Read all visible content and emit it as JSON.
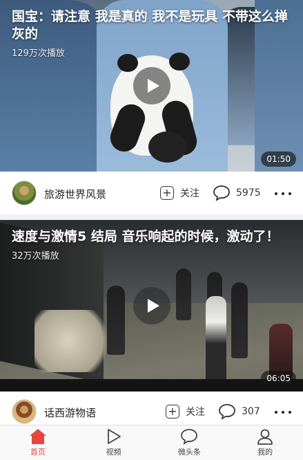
{
  "videos": [
    {
      "title": "国宝：请注意 我是真的 我不是玩具 不带这么掸灰的",
      "play_count": "129万次播放",
      "duration": "01:50",
      "channel": "旅游世界风景",
      "follow_label": "关注",
      "comment_count": "5975"
    },
    {
      "title": "速度与激情5 结局 音乐响起的时候，激动了！",
      "play_count": "32万次播放",
      "duration": "06:05",
      "channel": "话西游物语",
      "follow_label": "关注",
      "comment_count": "307"
    }
  ],
  "tabbar": {
    "items": [
      {
        "label": "首页",
        "icon": "home-icon",
        "active": true
      },
      {
        "label": "视频",
        "icon": "play-icon",
        "active": false
      },
      {
        "label": "微头条",
        "icon": "chat-bubble-icon",
        "active": false
      },
      {
        "label": "我的",
        "icon": "person-icon",
        "active": false
      }
    ]
  },
  "colors": {
    "accent": "#e8453c",
    "background": "#f2f2f2"
  }
}
